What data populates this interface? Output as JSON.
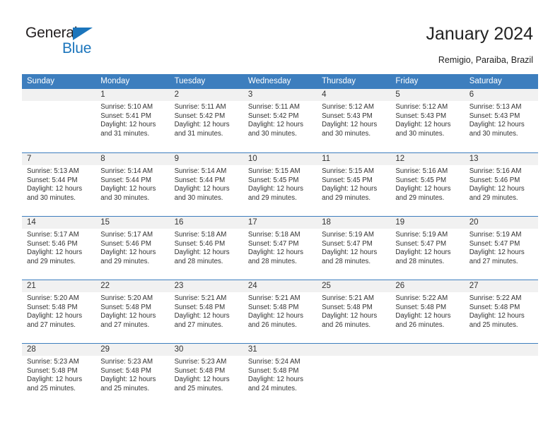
{
  "brand": {
    "name_part1": "General",
    "name_part2": "Blue",
    "triangle_icon": "blue-triangle-icon",
    "accent_color": "#1b75bc"
  },
  "header": {
    "title": "January 2024",
    "location": "Remigio, Paraiba, Brazil"
  },
  "theme": {
    "header_bg": "#3d7ebe",
    "date_strip_bg": "#f1f1f1",
    "text_color": "#333333"
  },
  "weekdays": [
    "Sunday",
    "Monday",
    "Tuesday",
    "Wednesday",
    "Thursday",
    "Friday",
    "Saturday"
  ],
  "weeks": [
    [
      {
        "date": "",
        "sunrise": "",
        "sunset": "",
        "daylight_line1": "",
        "daylight_line2": ""
      },
      {
        "date": "1",
        "sunrise": "Sunrise: 5:10 AM",
        "sunset": "Sunset: 5:41 PM",
        "daylight_line1": "Daylight: 12 hours",
        "daylight_line2": "and 31 minutes."
      },
      {
        "date": "2",
        "sunrise": "Sunrise: 5:11 AM",
        "sunset": "Sunset: 5:42 PM",
        "daylight_line1": "Daylight: 12 hours",
        "daylight_line2": "and 31 minutes."
      },
      {
        "date": "3",
        "sunrise": "Sunrise: 5:11 AM",
        "sunset": "Sunset: 5:42 PM",
        "daylight_line1": "Daylight: 12 hours",
        "daylight_line2": "and 30 minutes."
      },
      {
        "date": "4",
        "sunrise": "Sunrise: 5:12 AM",
        "sunset": "Sunset: 5:43 PM",
        "daylight_line1": "Daylight: 12 hours",
        "daylight_line2": "and 30 minutes."
      },
      {
        "date": "5",
        "sunrise": "Sunrise: 5:12 AM",
        "sunset": "Sunset: 5:43 PM",
        "daylight_line1": "Daylight: 12 hours",
        "daylight_line2": "and 30 minutes."
      },
      {
        "date": "6",
        "sunrise": "Sunrise: 5:13 AM",
        "sunset": "Sunset: 5:43 PM",
        "daylight_line1": "Daylight: 12 hours",
        "daylight_line2": "and 30 minutes."
      }
    ],
    [
      {
        "date": "7",
        "sunrise": "Sunrise: 5:13 AM",
        "sunset": "Sunset: 5:44 PM",
        "daylight_line1": "Daylight: 12 hours",
        "daylight_line2": "and 30 minutes."
      },
      {
        "date": "8",
        "sunrise": "Sunrise: 5:14 AM",
        "sunset": "Sunset: 5:44 PM",
        "daylight_line1": "Daylight: 12 hours",
        "daylight_line2": "and 30 minutes."
      },
      {
        "date": "9",
        "sunrise": "Sunrise: 5:14 AM",
        "sunset": "Sunset: 5:44 PM",
        "daylight_line1": "Daylight: 12 hours",
        "daylight_line2": "and 30 minutes."
      },
      {
        "date": "10",
        "sunrise": "Sunrise: 5:15 AM",
        "sunset": "Sunset: 5:45 PM",
        "daylight_line1": "Daylight: 12 hours",
        "daylight_line2": "and 29 minutes."
      },
      {
        "date": "11",
        "sunrise": "Sunrise: 5:15 AM",
        "sunset": "Sunset: 5:45 PM",
        "daylight_line1": "Daylight: 12 hours",
        "daylight_line2": "and 29 minutes."
      },
      {
        "date": "12",
        "sunrise": "Sunrise: 5:16 AM",
        "sunset": "Sunset: 5:45 PM",
        "daylight_line1": "Daylight: 12 hours",
        "daylight_line2": "and 29 minutes."
      },
      {
        "date": "13",
        "sunrise": "Sunrise: 5:16 AM",
        "sunset": "Sunset: 5:46 PM",
        "daylight_line1": "Daylight: 12 hours",
        "daylight_line2": "and 29 minutes."
      }
    ],
    [
      {
        "date": "14",
        "sunrise": "Sunrise: 5:17 AM",
        "sunset": "Sunset: 5:46 PM",
        "daylight_line1": "Daylight: 12 hours",
        "daylight_line2": "and 29 minutes."
      },
      {
        "date": "15",
        "sunrise": "Sunrise: 5:17 AM",
        "sunset": "Sunset: 5:46 PM",
        "daylight_line1": "Daylight: 12 hours",
        "daylight_line2": "and 29 minutes."
      },
      {
        "date": "16",
        "sunrise": "Sunrise: 5:18 AM",
        "sunset": "Sunset: 5:46 PM",
        "daylight_line1": "Daylight: 12 hours",
        "daylight_line2": "and 28 minutes."
      },
      {
        "date": "17",
        "sunrise": "Sunrise: 5:18 AM",
        "sunset": "Sunset: 5:47 PM",
        "daylight_line1": "Daylight: 12 hours",
        "daylight_line2": "and 28 minutes."
      },
      {
        "date": "18",
        "sunrise": "Sunrise: 5:19 AM",
        "sunset": "Sunset: 5:47 PM",
        "daylight_line1": "Daylight: 12 hours",
        "daylight_line2": "and 28 minutes."
      },
      {
        "date": "19",
        "sunrise": "Sunrise: 5:19 AM",
        "sunset": "Sunset: 5:47 PM",
        "daylight_line1": "Daylight: 12 hours",
        "daylight_line2": "and 28 minutes."
      },
      {
        "date": "20",
        "sunrise": "Sunrise: 5:19 AM",
        "sunset": "Sunset: 5:47 PM",
        "daylight_line1": "Daylight: 12 hours",
        "daylight_line2": "and 27 minutes."
      }
    ],
    [
      {
        "date": "21",
        "sunrise": "Sunrise: 5:20 AM",
        "sunset": "Sunset: 5:48 PM",
        "daylight_line1": "Daylight: 12 hours",
        "daylight_line2": "and 27 minutes."
      },
      {
        "date": "22",
        "sunrise": "Sunrise: 5:20 AM",
        "sunset": "Sunset: 5:48 PM",
        "daylight_line1": "Daylight: 12 hours",
        "daylight_line2": "and 27 minutes."
      },
      {
        "date": "23",
        "sunrise": "Sunrise: 5:21 AM",
        "sunset": "Sunset: 5:48 PM",
        "daylight_line1": "Daylight: 12 hours",
        "daylight_line2": "and 27 minutes."
      },
      {
        "date": "24",
        "sunrise": "Sunrise: 5:21 AM",
        "sunset": "Sunset: 5:48 PM",
        "daylight_line1": "Daylight: 12 hours",
        "daylight_line2": "and 26 minutes."
      },
      {
        "date": "25",
        "sunrise": "Sunrise: 5:21 AM",
        "sunset": "Sunset: 5:48 PM",
        "daylight_line1": "Daylight: 12 hours",
        "daylight_line2": "and 26 minutes."
      },
      {
        "date": "26",
        "sunrise": "Sunrise: 5:22 AM",
        "sunset": "Sunset: 5:48 PM",
        "daylight_line1": "Daylight: 12 hours",
        "daylight_line2": "and 26 minutes."
      },
      {
        "date": "27",
        "sunrise": "Sunrise: 5:22 AM",
        "sunset": "Sunset: 5:48 PM",
        "daylight_line1": "Daylight: 12 hours",
        "daylight_line2": "and 25 minutes."
      }
    ],
    [
      {
        "date": "28",
        "sunrise": "Sunrise: 5:23 AM",
        "sunset": "Sunset: 5:48 PM",
        "daylight_line1": "Daylight: 12 hours",
        "daylight_line2": "and 25 minutes."
      },
      {
        "date": "29",
        "sunrise": "Sunrise: 5:23 AM",
        "sunset": "Sunset: 5:48 PM",
        "daylight_line1": "Daylight: 12 hours",
        "daylight_line2": "and 25 minutes."
      },
      {
        "date": "30",
        "sunrise": "Sunrise: 5:23 AM",
        "sunset": "Sunset: 5:48 PM",
        "daylight_line1": "Daylight: 12 hours",
        "daylight_line2": "and 25 minutes."
      },
      {
        "date": "31",
        "sunrise": "Sunrise: 5:24 AM",
        "sunset": "Sunset: 5:48 PM",
        "daylight_line1": "Daylight: 12 hours",
        "daylight_line2": "and 24 minutes."
      },
      {
        "date": "",
        "sunrise": "",
        "sunset": "",
        "daylight_line1": "",
        "daylight_line2": ""
      },
      {
        "date": "",
        "sunrise": "",
        "sunset": "",
        "daylight_line1": "",
        "daylight_line2": ""
      },
      {
        "date": "",
        "sunrise": "",
        "sunset": "",
        "daylight_line1": "",
        "daylight_line2": ""
      }
    ]
  ]
}
